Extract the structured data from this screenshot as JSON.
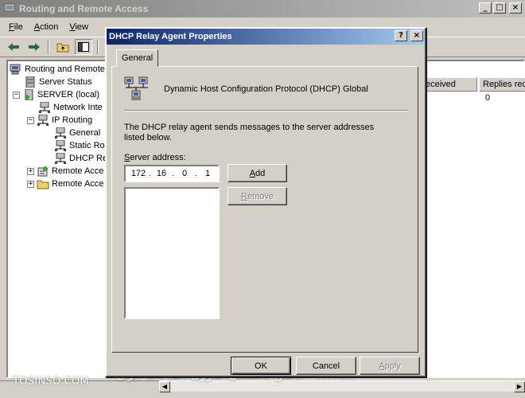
{
  "main_window": {
    "title": "Routing and Remote Access",
    "controls": {
      "minimize": "_",
      "maximize": "□",
      "close": "×"
    }
  },
  "menubar": {
    "items": [
      {
        "label": "File",
        "accel": "F",
        "rest": "ile"
      },
      {
        "label": "Action",
        "accel": "A",
        "rest": "ction"
      },
      {
        "label": "View",
        "accel": "V",
        "rest": "iew"
      }
    ]
  },
  "toolbar": {
    "icons": [
      "back-arrow-icon",
      "forward-arrow-icon",
      "up-folder-icon",
      "show-hide-tree-icon",
      "delete-icon"
    ]
  },
  "tree": {
    "items": [
      {
        "label": "Routing and Remote",
        "icon": "computer-icon",
        "level": 0,
        "expander": ""
      },
      {
        "label": "Server Status",
        "icon": "server-status-icon",
        "level": 1,
        "expander": ""
      },
      {
        "label": "SERVER (local)",
        "icon": "server-icon",
        "level": 1,
        "expander": "−"
      },
      {
        "label": "Network Inte",
        "icon": "network-icon",
        "level": 2,
        "expander": ""
      },
      {
        "label": "IP Routing",
        "icon": "network-icon",
        "level": 2,
        "expander": "−"
      },
      {
        "label": "General",
        "icon": "network-icon",
        "level": 3,
        "expander": ""
      },
      {
        "label": "Static Ro",
        "icon": "network-icon",
        "level": 3,
        "expander": ""
      },
      {
        "label": "DHCP Re",
        "icon": "network-icon",
        "level": 3,
        "expander": "",
        "selected": true
      },
      {
        "label": "Remote Acce",
        "icon": "policy-icon",
        "level": 2,
        "expander": "+"
      },
      {
        "label": "Remote Acce",
        "icon": "folder-icon",
        "level": 2,
        "expander": "+"
      }
    ]
  },
  "list": {
    "columns": [
      "eceived",
      "Replies rec"
    ],
    "rows": [
      [
        "",
        "0"
      ]
    ]
  },
  "dialog": {
    "title": "DHCP Relay Agent Properties",
    "help_btn": "?",
    "close_btn": "×",
    "tab": "General",
    "heading": "Dynamic Host Configuration Protocol (DHCP) Global",
    "description": "The DHCP relay agent sends messages to the server addresses listed below.",
    "server_address_label": {
      "accel": "S",
      "rest": "erver address:"
    },
    "ip": [
      "172",
      "16",
      "0",
      "1"
    ],
    "ip_separator": ".",
    "add_button": {
      "accel": "A",
      "rest": "dd"
    },
    "remove_button": {
      "accel": "R",
      "rest": "emove"
    },
    "ok_button": "OK",
    "cancel_button": "Cancel",
    "apply_button": {
      "accel": "A",
      "rest": "pply"
    }
  },
  "watermark": {
    "left": "TOSINSO.COM",
    "right": "ITPro.ir - انجمن تخصصی فناوری اطلاعات ایران"
  },
  "colors": {
    "title_active": "#0a246a",
    "title_inactive": "#808080",
    "face": "#d4d0c8"
  }
}
